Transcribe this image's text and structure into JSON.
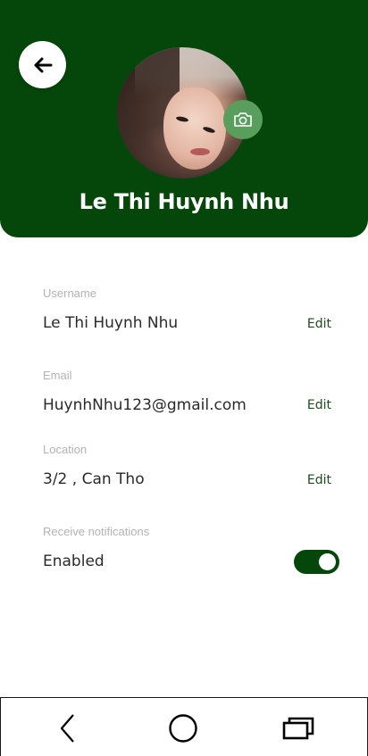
{
  "profile": {
    "name": "Le Thi Huynh Nhu"
  },
  "icons": {
    "back": "arrow-left-icon",
    "camera": "camera-icon"
  },
  "fields": {
    "username": {
      "label": "Username",
      "value": "Le Thi Huynh Nhu",
      "action": "Edit"
    },
    "email": {
      "label": "Email",
      "value": "HuynhNhu123@gmail.com",
      "action": "Edit"
    },
    "location": {
      "label": "Location",
      "value": "3/2 , Can Tho",
      "action": "Edit"
    },
    "notifications": {
      "label": "Receive notifications",
      "value": "Enabled",
      "toggle_on": true
    }
  },
  "colors": {
    "header": "#05470b",
    "camera_button": "#5a9e5e",
    "toggle": "#05470b",
    "edit_text": "#1d4a1f"
  }
}
